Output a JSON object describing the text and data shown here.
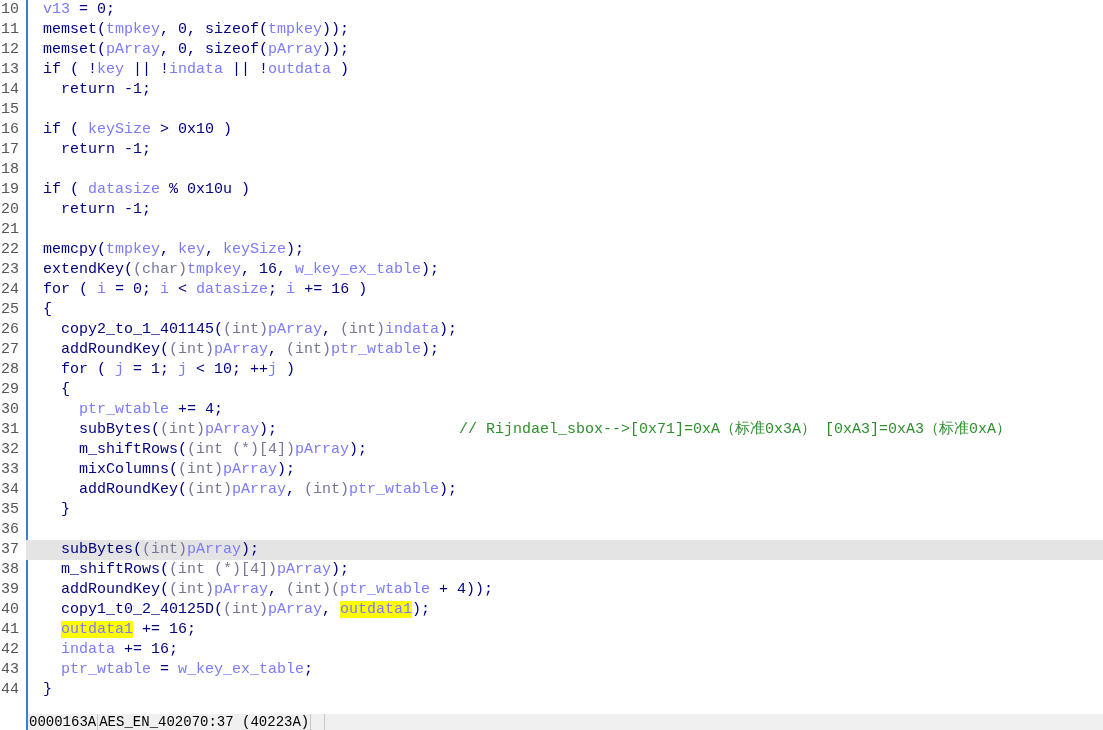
{
  "code_view": {
    "lines": [
      {
        "number": "10",
        "current": false,
        "tokens": [
          {
            "kind": "var",
            "text": "v13"
          },
          {
            "kind": "plain",
            "text": " = 0;"
          }
        ]
      },
      {
        "number": "11",
        "current": false,
        "tokens": [
          {
            "kind": "plain",
            "text": "memset("
          },
          {
            "kind": "var",
            "text": "tmpkey"
          },
          {
            "kind": "plain",
            "text": ", 0, sizeof("
          },
          {
            "kind": "var",
            "text": "tmpkey"
          },
          {
            "kind": "plain",
            "text": "));"
          }
        ]
      },
      {
        "number": "12",
        "current": false,
        "tokens": [
          {
            "kind": "plain",
            "text": "memset("
          },
          {
            "kind": "var",
            "text": "pArray"
          },
          {
            "kind": "plain",
            "text": ", 0, sizeof("
          },
          {
            "kind": "var",
            "text": "pArray"
          },
          {
            "kind": "plain",
            "text": "));"
          }
        ]
      },
      {
        "number": "13",
        "current": false,
        "tokens": [
          {
            "kind": "plain",
            "text": "if ( !"
          },
          {
            "kind": "var",
            "text": "key"
          },
          {
            "kind": "plain",
            "text": " || !"
          },
          {
            "kind": "var",
            "text": "indata"
          },
          {
            "kind": "plain",
            "text": " || !"
          },
          {
            "kind": "var",
            "text": "outdata"
          },
          {
            "kind": "plain",
            "text": " )"
          }
        ],
        "children": [
          {
            "number": "14",
            "current": false,
            "tokens": [
              {
                "kind": "plain",
                "text": "return -1;"
              }
            ]
          }
        ]
      },
      {
        "number": "15",
        "current": false
      },
      {
        "number": "16",
        "current": false,
        "tokens": [
          {
            "kind": "plain",
            "text": "if ( "
          },
          {
            "kind": "var",
            "text": "keySize"
          },
          {
            "kind": "plain",
            "text": " > 0x10 )"
          }
        ],
        "children": [
          {
            "number": "17",
            "current": false,
            "tokens": [
              {
                "kind": "plain",
                "text": "return -1;"
              }
            ]
          }
        ]
      },
      {
        "number": "18",
        "current": false
      },
      {
        "number": "19",
        "current": false,
        "tokens": [
          {
            "kind": "plain",
            "text": "if ( "
          },
          {
            "kind": "var",
            "text": "datasize"
          },
          {
            "kind": "plain",
            "text": " % 0x10u )"
          }
        ],
        "children": [
          {
            "number": "20",
            "current": false,
            "tokens": [
              {
                "kind": "plain",
                "text": "return -1;"
              }
            ]
          }
        ]
      },
      {
        "number": "21",
        "current": false
      },
      {
        "number": "22",
        "current": false,
        "tokens": [
          {
            "kind": "plain",
            "text": "memcpy("
          },
          {
            "kind": "var",
            "text": "tmpkey"
          },
          {
            "kind": "plain",
            "text": ", "
          },
          {
            "kind": "var",
            "text": "key"
          },
          {
            "kind": "plain",
            "text": ", "
          },
          {
            "kind": "var",
            "text": "keySize"
          },
          {
            "kind": "plain",
            "text": ");"
          }
        ]
      },
      {
        "number": "23",
        "current": false,
        "tokens": [
          {
            "kind": "plain",
            "text": "extendKey("
          },
          {
            "kind": "cast",
            "text": "(char)"
          },
          {
            "kind": "var",
            "text": "tmpkey"
          },
          {
            "kind": "plain",
            "text": ", 16, "
          },
          {
            "kind": "var",
            "text": "w_key_ex_table"
          },
          {
            "kind": "plain",
            "text": ");"
          }
        ]
      },
      {
        "number": "24",
        "current": false,
        "tokens": [
          {
            "kind": "plain",
            "text": "for ( "
          },
          {
            "kind": "var",
            "text": "i"
          },
          {
            "kind": "plain",
            "text": " = 0; "
          },
          {
            "kind": "var",
            "text": "i"
          },
          {
            "kind": "plain",
            "text": " < "
          },
          {
            "kind": "var",
            "text": "datasize"
          },
          {
            "kind": "plain",
            "text": "; "
          },
          {
            "kind": "var",
            "text": "i"
          },
          {
            "kind": "plain",
            "text": " += 16 )"
          }
        ]
      },
      {
        "number": "25",
        "current": false,
        "tokens": [
          {
            "kind": "plain",
            "text": "{"
          }
        ],
        "children": [
          {
            "number": "26",
            "current": false,
            "tokens": [
              {
                "kind": "plain",
                "text": "copy2_to_1_401145("
              },
              {
                "kind": "cast",
                "text": "(int)"
              },
              {
                "kind": "var",
                "text": "pArray"
              },
              {
                "kind": "plain",
                "text": ", "
              },
              {
                "kind": "cast",
                "text": "(int)"
              },
              {
                "kind": "var",
                "text": "indata"
              },
              {
                "kind": "plain",
                "text": ");"
              }
            ]
          },
          {
            "number": "27",
            "current": false,
            "tokens": [
              {
                "kind": "plain",
                "text": "addRoundKey("
              },
              {
                "kind": "cast",
                "text": "(int)"
              },
              {
                "kind": "var",
                "text": "pArray"
              },
              {
                "kind": "plain",
                "text": ", "
              },
              {
                "kind": "cast",
                "text": "(int)"
              },
              {
                "kind": "var",
                "text": "ptr_wtable"
              },
              {
                "kind": "plain",
                "text": ");"
              }
            ]
          },
          {
            "number": "28",
            "current": false,
            "tokens": [
              {
                "kind": "plain",
                "text": "for ( "
              },
              {
                "kind": "var",
                "text": "j"
              },
              {
                "kind": "plain",
                "text": " = 1; "
              },
              {
                "kind": "var",
                "text": "j"
              },
              {
                "kind": "plain",
                "text": " < 10; ++"
              },
              {
                "kind": "var",
                "text": "j"
              },
              {
                "kind": "plain",
                "text": " )"
              }
            ]
          },
          {
            "number": "29",
            "current": false,
            "tokens": [
              {
                "kind": "plain",
                "text": "{"
              }
            ],
            "children": [
              {
                "number": "30",
                "current": false,
                "tokens": [
                  {
                    "kind": "var",
                    "text": "ptr_wtable"
                  },
                  {
                    "kind": "plain",
                    "text": " += 4;"
                  }
                ]
              },
              {
                "number": "31",
                "current": false,
                "tokens": [
                  {
                    "kind": "plain",
                    "text": "subBytes("
                  },
                  {
                    "kind": "cast",
                    "text": "(int)"
                  },
                  {
                    "kind": "var",
                    "text": "pArray"
                  },
                  {
                    "kind": "plain",
                    "text": ");"
                  },
                  {
                    "kind": "comment",
                    "text": "// Rijndael_sbox-->[0x71]=0xA（标准0x3A） [0xA3]=0xA3（标准0xA）"
                  }
                ]
              },
              {
                "number": "32",
                "current": false,
                "tokens": [
                  {
                    "kind": "plain",
                    "text": "m_shiftRows("
                  },
                  {
                    "kind": "cast",
                    "text": "(int (*)[4])"
                  },
                  {
                    "kind": "var",
                    "text": "pArray"
                  },
                  {
                    "kind": "plain",
                    "text": ");"
                  }
                ]
              },
              {
                "number": "33",
                "current": false,
                "tokens": [
                  {
                    "kind": "plain",
                    "text": "mixColumns("
                  },
                  {
                    "kind": "cast",
                    "text": "(int)"
                  },
                  {
                    "kind": "var",
                    "text": "pArray"
                  },
                  {
                    "kind": "plain",
                    "text": ");"
                  }
                ]
              },
              {
                "number": "34",
                "current": false,
                "tokens": [
                  {
                    "kind": "plain",
                    "text": "addRoundKey("
                  },
                  {
                    "kind": "cast",
                    "text": "(int)"
                  },
                  {
                    "kind": "var",
                    "text": "pArray"
                  },
                  {
                    "kind": "plain",
                    "text": ", "
                  },
                  {
                    "kind": "cast",
                    "text": "(int)"
                  },
                  {
                    "kind": "var",
                    "text": "ptr_wtable"
                  },
                  {
                    "kind": "plain",
                    "text": ");"
                  }
                ]
              }
            ]
          },
          {
            "number": "35",
            "current": false,
            "tokens": [
              {
                "kind": "plain",
                "text": "}"
              }
            ]
          },
          {
            "number": "36",
            "current": false
          },
          {
            "number": "37",
            "current": true,
            "tokens": [
              {
                "kind": "plain",
                "text": "subBytes("
              },
              {
                "kind": "cast",
                "text": "(int)"
              },
              {
                "kind": "var",
                "text": "pArray"
              },
              {
                "kind": "plain",
                "text": ");"
              }
            ]
          },
          {
            "number": "38",
            "current": false,
            "tokens": [
              {
                "kind": "plain",
                "text": "m_shiftRows("
              },
              {
                "kind": "cast",
                "text": "(int (*)[4])"
              },
              {
                "kind": "var",
                "text": "pArray"
              },
              {
                "kind": "plain",
                "text": ");"
              }
            ]
          },
          {
            "number": "39",
            "current": false,
            "tokens": [
              {
                "kind": "plain",
                "text": "addRoundKey("
              },
              {
                "kind": "cast",
                "text": "(int)"
              },
              {
                "kind": "var",
                "text": "pArray"
              },
              {
                "kind": "plain",
                "text": ", "
              },
              {
                "kind": "cast",
                "text": "(int)("
              },
              {
                "kind": "var",
                "text": "ptr_wtable"
              },
              {
                "kind": "plain",
                "text": " + 4));"
              }
            ]
          },
          {
            "number": "40",
            "current": false,
            "tokens": [
              {
                "kind": "plain",
                "text": "copy1_t0_2_40125D("
              },
              {
                "kind": "cast",
                "text": "(int)"
              },
              {
                "kind": "var",
                "text": "pArray"
              },
              {
                "kind": "plain",
                "text": ", "
              },
              {
                "kind": "highlight",
                "text": "outdata1"
              },
              {
                "kind": "plain",
                "text": ");"
              }
            ]
          },
          {
            "number": "41",
            "current": false,
            "tokens": [
              {
                "kind": "highlight",
                "text": "outdata1"
              },
              {
                "kind": "plain",
                "text": " += 16;"
              }
            ]
          },
          {
            "number": "42",
            "current": false,
            "tokens": [
              {
                "kind": "var",
                "text": "indata"
              },
              {
                "kind": "plain",
                "text": " += 16;"
              }
            ]
          },
          {
            "number": "43",
            "current": false,
            "tokens": [
              {
                "kind": "var",
                "text": "ptr_wtable"
              },
              {
                "kind": "plain",
                "text": " = "
              },
              {
                "kind": "var",
                "text": "w_key_ex_table"
              },
              {
                "kind": "plain",
                "text": ";"
              }
            ]
          }
        ]
      },
      {
        "number": "44",
        "current": false,
        "tokens": [
          {
            "kind": "plain",
            "text": "}"
          }
        ]
      }
    ]
  },
  "status_bar": {
    "fields": [
      "0000163A",
      "AES_EN_402070:37 (40223A)"
    ]
  }
}
